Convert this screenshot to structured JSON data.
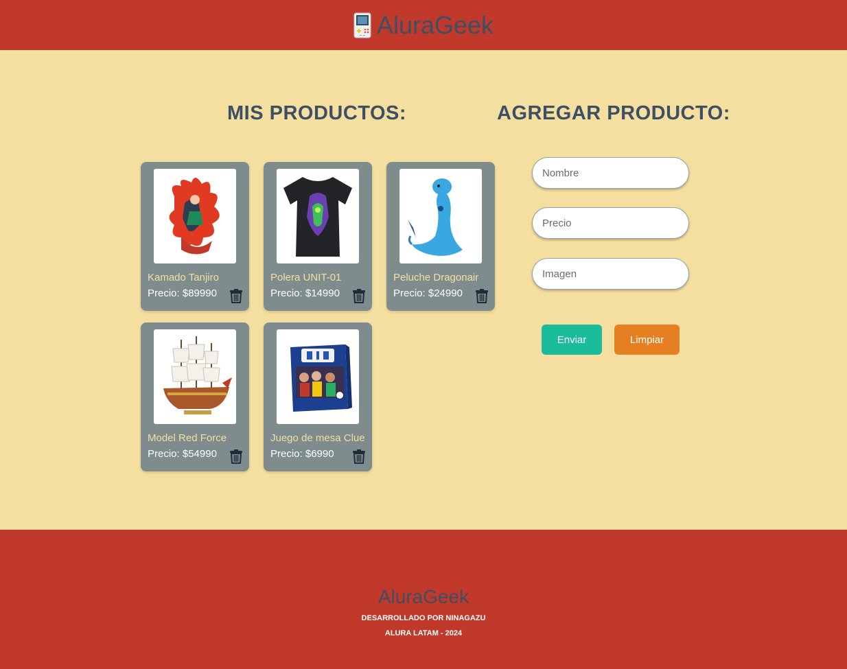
{
  "header": {
    "brand": "AluraGeek",
    "logo_icon": "gameboy-icon"
  },
  "products_section": {
    "title": "MIS PRODUCTOS:"
  },
  "add_section": {
    "title": "AGREGAR PRODUCTO:",
    "fields": {
      "name_placeholder": "Nombre",
      "price_placeholder": "Precio",
      "image_placeholder": "Imagen"
    },
    "buttons": {
      "send": "Enviar",
      "clear": "Limpiar"
    }
  },
  "products": [
    {
      "name": "Kamado Tanjiro",
      "price": "Precio: $89990",
      "image_icon": "anime-figure-icon"
    },
    {
      "name": "Polera UNIT-01",
      "price": "Precio: $14990",
      "image_icon": "tshirt-icon"
    },
    {
      "name": "Peluche Dragonair",
      "price": "Precio: $24990",
      "image_icon": "dragon-plush-icon"
    },
    {
      "name": "Model Red Force",
      "price": "Precio: $54990",
      "image_icon": "ship-model-icon"
    },
    {
      "name": "Juego de mesa Clue",
      "price": "Precio: $6990",
      "image_icon": "board-game-icon"
    }
  ],
  "footer": {
    "brand": "AluraGeek",
    "line1": "DESARROLLADO POR NINAGAZU",
    "line2": "ALURA LATAM - 2024"
  },
  "colors": {
    "header_footer_bg": "#c0392b",
    "page_bg": "#f5dfa0",
    "card_bg": "#7f8c8d",
    "text_dark": "#3d4f63",
    "send_button": "#1abc9c",
    "clear_button": "#e67e22"
  }
}
